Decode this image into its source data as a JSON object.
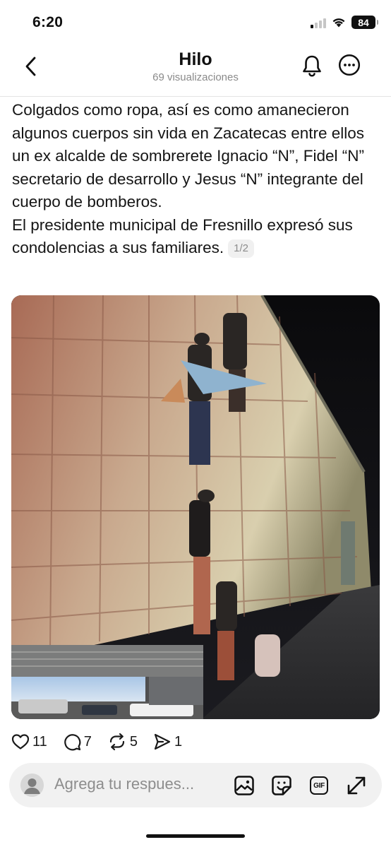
{
  "status_bar": {
    "time": "6:20",
    "battery": "84"
  },
  "header": {
    "title": "Hilo",
    "views": "69 visualizaciones",
    "back_icon": "chevron-left-icon",
    "notify_icon": "bell-icon",
    "more_icon": "more-circle-icon"
  },
  "post": {
    "paragraph1": "Colgados como ropa, así es como amanecieron algunos cuerpos sin vida en Zacatecas entre ellos un ex alcalde de sombrerete Ignacio “N”, Fidel “N” secretario de desarrollo y Jesus “N” integrante del cuerpo de bomberos.",
    "paragraph2": "El presidente municipal de Fresnillo expresó sus condolencias a sus familiares.",
    "page_indicator": "1/2"
  },
  "actions": {
    "likes": "11",
    "replies": "7",
    "reposts": "5",
    "shares": "1"
  },
  "reply_bar": {
    "placeholder": "Agrega tu respues...",
    "gif_label": "GIF"
  },
  "colors": {
    "text": "#101010",
    "muted": "#8a8a8a",
    "reply_bar_bg": "#f1f1f1"
  }
}
